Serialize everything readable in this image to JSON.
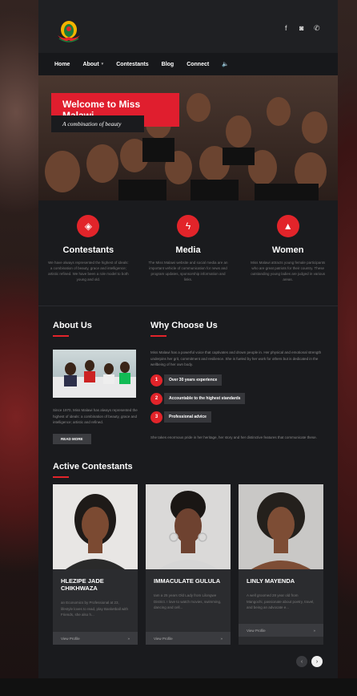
{
  "social": {
    "icons": [
      "facebook-icon",
      "instagram-icon",
      "whatsapp-icon"
    ],
    "glyphs": [
      "f",
      "◙",
      "✆"
    ]
  },
  "nav": {
    "items": [
      "Home",
      "About",
      "Contestants",
      "Blog",
      "Connect"
    ],
    "caret": "▾",
    "sound_glyph": "🔈"
  },
  "hero": {
    "title": "Welcome to Miss Malawi",
    "subtitle": "A combination of beauty"
  },
  "features": [
    {
      "icon": "diamond-icon",
      "glyph": "◈",
      "title": "Contestants",
      "text": "We have always represented the highest of ideals: a combination of beauty, grace and intelligence; artistic refined. We have been a role model to both young and old."
    },
    {
      "icon": "bolt-icon",
      "glyph": "ϟ",
      "title": "Media",
      "text": "The Miss Malawi website and social media are an important vehicle of communication for news and program updates, sponsorship information and links."
    },
    {
      "icon": "flame-icon",
      "glyph": "▲",
      "title": "Women",
      "text": "Miss Malawi attracts young female participants who are great patriots for their country. These outstanding young ladies are judged in various areas."
    }
  ],
  "about": {
    "title": "About Us",
    "text": "Since 1970, Miss Malawi has always represented the highest of ideals: a combination of beauty, grace and intelligence; artistic and refined.",
    "button": "READ MORE"
  },
  "why": {
    "title": "Why Choose Us",
    "intro": "Miss Malawi has a powerful voice that captivates and drown people in. Her physical and emotional strength underpins her grit, commitment and resilience. She is fueled by her work for others but is dedicated in the wellbeing of her own body.",
    "steps": [
      {
        "num": "1",
        "label": "Over 30 years experience"
      },
      {
        "num": "2",
        "label": "Accountable to the highest standards"
      },
      {
        "num": "3",
        "label": "Professional advice"
      }
    ],
    "outro": "She takes enormous pride in her heritage, her story and her distinctive features that communicate these."
  },
  "contestants": {
    "title": "Active Contestants",
    "items": [
      {
        "name": "HLEZIPE JADE CHIKHWAZA",
        "text": "an Economics by Professional at 23, lifestyle loves to read, play Basketball with Friends, she also h...",
        "link": "View Profile",
        "chev": "»"
      },
      {
        "name": "IMMACULATE GULULA",
        "text": "Iam a 25 years Old Lady from Lilongwe District. I love to watch movies, swimming, dancing and cell...",
        "link": "View Profile",
        "chev": "»"
      },
      {
        "name": "LINLY MAYENDA",
        "text": "A well groomed 28 year old from Mangochi, passionate about poetry, travel, and being an advocate e...",
        "link": "View Profile",
        "chev": "»"
      }
    ],
    "prev": "‹",
    "next": "›"
  },
  "colors": {
    "accent": "#e2242a"
  }
}
